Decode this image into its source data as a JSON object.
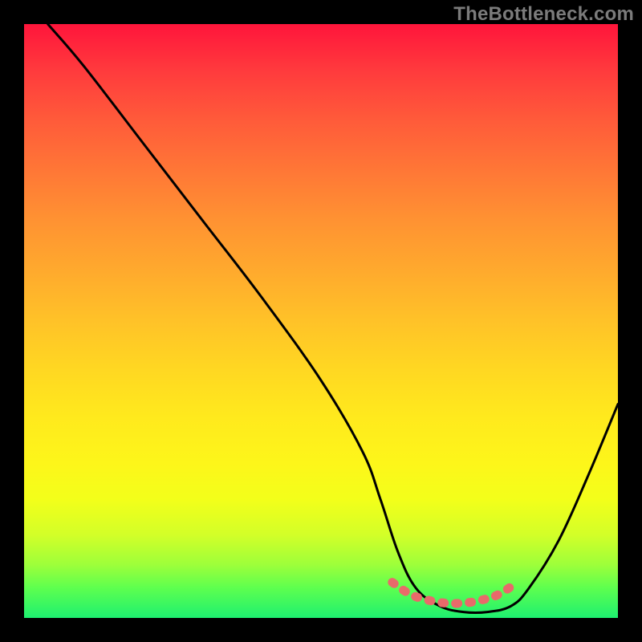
{
  "watermark": "TheBottleneck.com",
  "chart_data": {
    "type": "line",
    "title": "",
    "xlabel": "",
    "ylabel": "",
    "xlim": [
      0,
      100
    ],
    "ylim": [
      0,
      100
    ],
    "legend": false,
    "grid": false,
    "series": [
      {
        "name": "bottleneck-curve",
        "color": "#000000",
        "x": [
          4,
          10,
          20,
          30,
          40,
          50,
          57,
          60,
          63,
          66,
          70,
          74,
          78,
          82,
          85,
          90,
          95,
          100
        ],
        "y": [
          100,
          93,
          80,
          67,
          54,
          40,
          28,
          20,
          11,
          5,
          2,
          1,
          1,
          2,
          5,
          13,
          24,
          36
        ]
      },
      {
        "name": "optimal-band",
        "color": "#e86a6a",
        "x": [
          62,
          65,
          68,
          71,
          74,
          77,
          80,
          83
        ],
        "y": [
          6,
          4,
          3,
          2.5,
          2.5,
          3,
          4,
          6
        ]
      }
    ],
    "valley_x": 75,
    "annotations": []
  },
  "colors": {
    "background": "#000000",
    "watermark": "#7b7b7b",
    "curve": "#000000",
    "band": "#e86a6a"
  }
}
